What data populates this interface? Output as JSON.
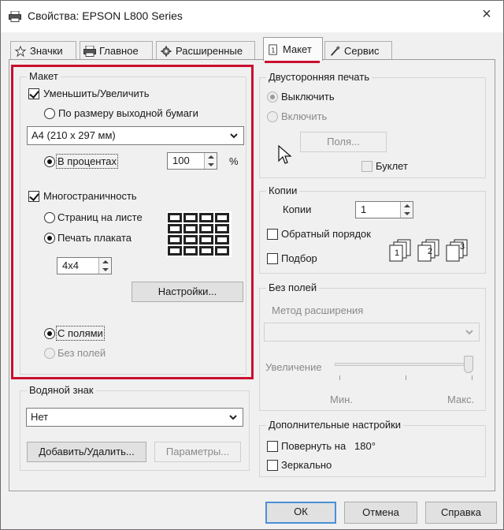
{
  "window": {
    "title": "Свойства: EPSON L800 Series",
    "close_icon": "×"
  },
  "tabs": [
    {
      "label": "Значки",
      "icon": "star-icon",
      "active": false
    },
    {
      "label": "Главное",
      "icon": "printer-icon",
      "active": false
    },
    {
      "label": "Расширенные",
      "icon": "gear-icon",
      "active": false
    },
    {
      "label": "Макет",
      "icon": "page-icon",
      "active": true
    },
    {
      "label": "Сервис",
      "icon": "brush-icon",
      "active": false
    }
  ],
  "layout": {
    "title": "Макет",
    "reduce_enlarge": {
      "label": "Уменьшить/Увеличить",
      "checked": true
    },
    "fit_to_output": {
      "label": "По размеру выходной бумаги",
      "selected": false
    },
    "paper_size": "A4 (210 x 297 мм)",
    "percent": {
      "label": "В процентах",
      "selected": true,
      "value": "100",
      "unit": "%"
    },
    "multipage": {
      "label": "Многостраничность",
      "checked": true
    },
    "pages_per_sheet": {
      "label": "Страниц на листе",
      "selected": false
    },
    "poster": {
      "label": "Печать плаката",
      "selected": true,
      "value": "4x4"
    },
    "settings_button": "Настройки...",
    "with_margins": {
      "label": "С полями",
      "selected": true
    },
    "borderless": {
      "label": "Без полей",
      "selected": false,
      "disabled": true
    }
  },
  "watermark": {
    "title": "Водяной знак",
    "selected": "Нет",
    "add_remove_button": "Добавить/Удалить...",
    "parameters_button": "Параметры..."
  },
  "duplex": {
    "title": "Двусторонняя печать",
    "off": {
      "label": "Выключить",
      "selected": true
    },
    "on": {
      "label": "Включить",
      "selected": false
    },
    "margins_button": "Поля...",
    "booklet": {
      "label": "Буклет",
      "checked": false
    }
  },
  "copies": {
    "title": "Копии",
    "label": "Копии",
    "value": "1",
    "reverse_order": {
      "label": "Обратный порядок",
      "checked": false
    },
    "collate": {
      "label": "Подбор",
      "checked": false
    },
    "collate_numbers": [
      "1",
      "2",
      "3"
    ]
  },
  "borderless_group": {
    "title": "Без полей",
    "expansion_method": "Метод расширения",
    "expansion_value": "",
    "increase_label": "Увеличение",
    "min_label": "Мин.",
    "max_label": "Макс.",
    "slider_level": 1.0
  },
  "additional": {
    "title": "Дополнительные настройки",
    "rotate": {
      "label": "Повернуть на   180°",
      "checked": false
    },
    "mirror": {
      "label": "Зеркально",
      "checked": false
    }
  },
  "footer": {
    "ok": "ОК",
    "cancel": "Отмена",
    "help": "Справка"
  },
  "colors": {
    "highlight": "#c8102e",
    "focus": "#4a8fd8"
  }
}
